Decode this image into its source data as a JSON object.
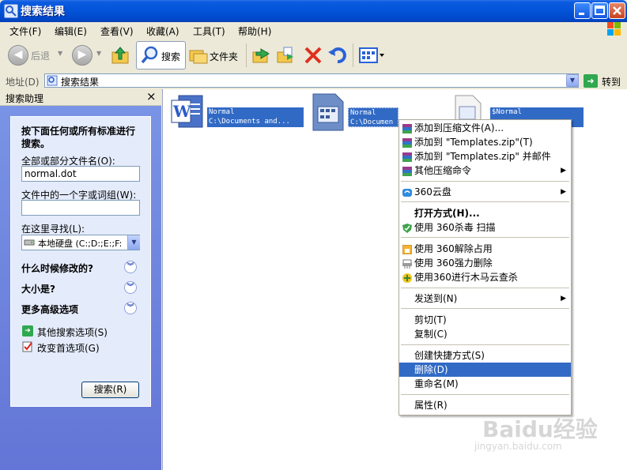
{
  "window": {
    "title": "搜索结果"
  },
  "menu": [
    {
      "label": "文件(F)"
    },
    {
      "label": "编辑(E)"
    },
    {
      "label": "查看(V)"
    },
    {
      "label": "收藏(A)"
    },
    {
      "label": "工具(T)"
    },
    {
      "label": "帮助(H)"
    }
  ],
  "toolbar": {
    "back": "后退",
    "search": "搜索",
    "folders": "文件夹"
  },
  "address": {
    "label": "地址(D)",
    "value": "搜索结果",
    "go": "转到"
  },
  "pane": {
    "title": "搜索助理",
    "close": "×",
    "heading": "按下面任何或所有标准进行搜索。",
    "filename_label": "全部或部分文件名(O):",
    "filename_value": "normal.dot",
    "phrase_label": "文件中的一个字或词组(W):",
    "phrase_value": "",
    "lookin_label": "在这里寻找(L):",
    "lookin_value": "本地硬盘 (C:;D:;E:;F:",
    "sections": [
      "什么时候修改的?",
      "大小是?",
      "更多高级选项"
    ],
    "links": [
      "其他搜索选项(S)",
      "改变首选项(G)"
    ],
    "search_button": "搜索(R)"
  },
  "files": [
    {
      "line1": "Normal",
      "line2": "C:\\Documents and..."
    },
    {
      "line1": "Normal",
      "line2": "C:\\Documen"
    },
    {
      "line1": "$Normal",
      "line2": ""
    }
  ],
  "context_menu": [
    {
      "label": "添加到压缩文件(A)...",
      "icon": "winrar-icon"
    },
    {
      "label": "添加到 \"Templates.zip\"(T)",
      "icon": "winrar-icon"
    },
    {
      "label": "添加到 \"Templates.zip\" 并邮件",
      "icon": "winrar-icon"
    },
    {
      "label": "其他压缩命令",
      "icon": "winrar-icon",
      "submenu": true
    },
    {
      "label": "360云盘",
      "icon": "cloud-icon",
      "submenu": true
    },
    {
      "label": "打开方式(H)...",
      "bold": true
    },
    {
      "label": "使用 360杀毒 扫描",
      "icon": "shield-icon"
    },
    {
      "label": "使用 360解除占用",
      "icon": "unlock-icon"
    },
    {
      "label": "使用 360强力删除",
      "icon": "shredder-icon"
    },
    {
      "label": "使用360进行木马云查杀",
      "icon": "plus-icon"
    },
    {
      "label": "发送到(N)",
      "submenu": true
    },
    {
      "label": "剪切(T)"
    },
    {
      "label": "复制(C)"
    },
    {
      "label": "创建快捷方式(S)"
    },
    {
      "label": "删除(D)",
      "selected": true
    },
    {
      "label": "重命名(M)"
    },
    {
      "label": "属性(R)"
    }
  ],
  "watermark": {
    "line1": "Baidu经验",
    "line2": "jingyan.baidu.com"
  },
  "colors": {
    "selection": "#316AC5",
    "titlebar": "#0353D8",
    "pane": "#6375D6"
  }
}
